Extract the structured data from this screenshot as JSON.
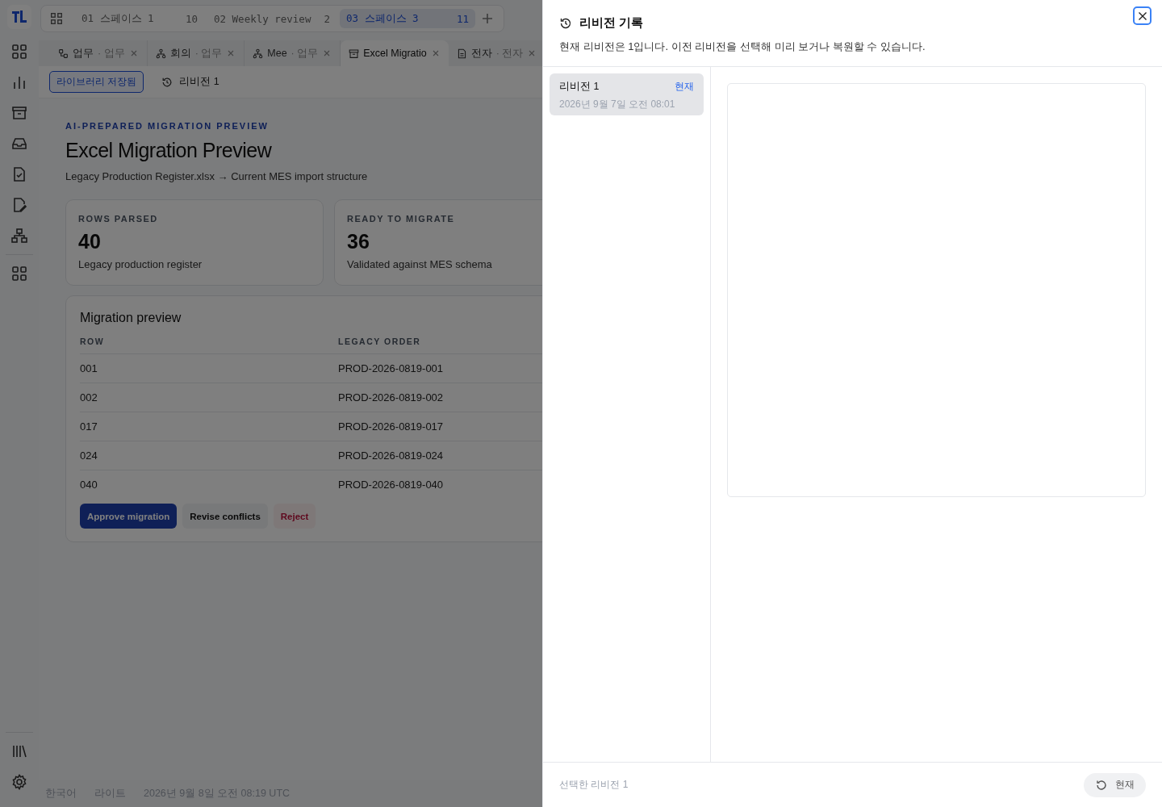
{
  "spaces": [
    {
      "label": "01 스페이스 1",
      "count": "10",
      "selected": false
    },
    {
      "label": "02 Weekly review",
      "count": "2",
      "selected": false
    },
    {
      "label": "03 스페이스 3",
      "count": "11",
      "selected": true
    }
  ],
  "tabs": [
    {
      "kind": "flow",
      "title": "업무",
      "subtitle": "· 업무",
      "selected": false
    },
    {
      "kind": "tree",
      "title": "회의",
      "subtitle": "· 업무",
      "selected": false
    },
    {
      "kind": "tree",
      "title": "Mee",
      "subtitle": "· 업무",
      "selected": false
    },
    {
      "kind": "archive",
      "title": "Excel Migratio",
      "selected": true
    },
    {
      "kind": "doc",
      "title": "전자",
      "subtitle": "· 전자",
      "selected": false
    }
  ],
  "toolbar": {
    "saved_badge": "라이브러리 저장됨",
    "revision": "리비전 1"
  },
  "page": {
    "eyebrow": "AI-PREPARED MIGRATION PREVIEW",
    "title": "Excel Migration Preview",
    "subtitle": "Legacy Production Register.xlsx → Current MES import structure"
  },
  "stats": [
    {
      "label": "ROWS PARSED",
      "value": "40",
      "caption": "Legacy production register"
    },
    {
      "label": "READY TO MIGRATE",
      "value": "36",
      "caption": "Validated against MES schema"
    }
  ],
  "table": {
    "title": "Migration preview",
    "columns": [
      "ROW",
      "LEGACY ORDER"
    ],
    "rows": [
      [
        "001",
        "PROD-2026-0819-001"
      ],
      [
        "002",
        "PROD-2026-0819-002"
      ],
      [
        "017",
        "PROD-2026-0819-017"
      ],
      [
        "024",
        "PROD-2026-0819-024"
      ],
      [
        "040",
        "PROD-2026-0819-040"
      ]
    ]
  },
  "actions": [
    {
      "kind": "primary",
      "label": "Approve migration"
    },
    {
      "kind": "secondary",
      "label": "Revise conflicts"
    },
    {
      "kind": "danger",
      "label": "Reject"
    }
  ],
  "status_bar": [
    "한국어",
    "라이트",
    "2026년 9월 8일 오전 08:19 UTC"
  ],
  "drawer": {
    "title": "리비전 기록",
    "description": "현재 리비전은 1입니다. 이전 리비전을 선택해 미리 보거나 복원할 수 있습니다.",
    "revisions": [
      {
        "name": "리비전 1",
        "date": "2026년 9월 7일 오전 08:01",
        "badge": "현재",
        "selected": true
      }
    ],
    "selected_label": "선택한 리비전 1",
    "restore_button": "현재"
  }
}
